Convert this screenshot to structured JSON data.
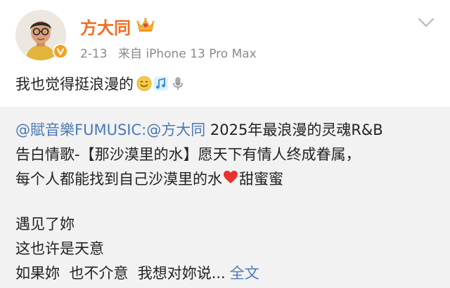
{
  "author": {
    "name": "方大同",
    "badge_icon": "crown-icon",
    "verified_icon": "verified-v-icon"
  },
  "meta": {
    "date": "2-13",
    "source": "来自 iPhone 13 Pro Max"
  },
  "post": {
    "text": "我也觉得挺浪漫的",
    "emojis": [
      "smile-emoji-icon",
      "music-note-icon",
      "microphone-icon"
    ]
  },
  "repost": {
    "mention_1": "@賦音樂FUMUSIC",
    "separator": " :",
    "mention_2": "@方大同",
    "line1_rest": " 2025年最浪漫的灵魂R&B",
    "line2": "告白情歌-【那沙漠里的水】愿天下有情人终成眷属，",
    "line3_a": "每个人都能找到自己沙漠里的水",
    "line3_heart_icon": "red-heart-icon",
    "line3_b": "甜蜜蜜",
    "line4": "遇见了妳",
    "line5": "这也许是天意",
    "line6": "如果妳  也不介意  我想对妳说...",
    "more_label": "全文"
  },
  "colors": {
    "username": "#f36c21",
    "link": "#4a79b5",
    "meta": "#8a8a8a",
    "repost_bg": "#f2f2f2"
  }
}
